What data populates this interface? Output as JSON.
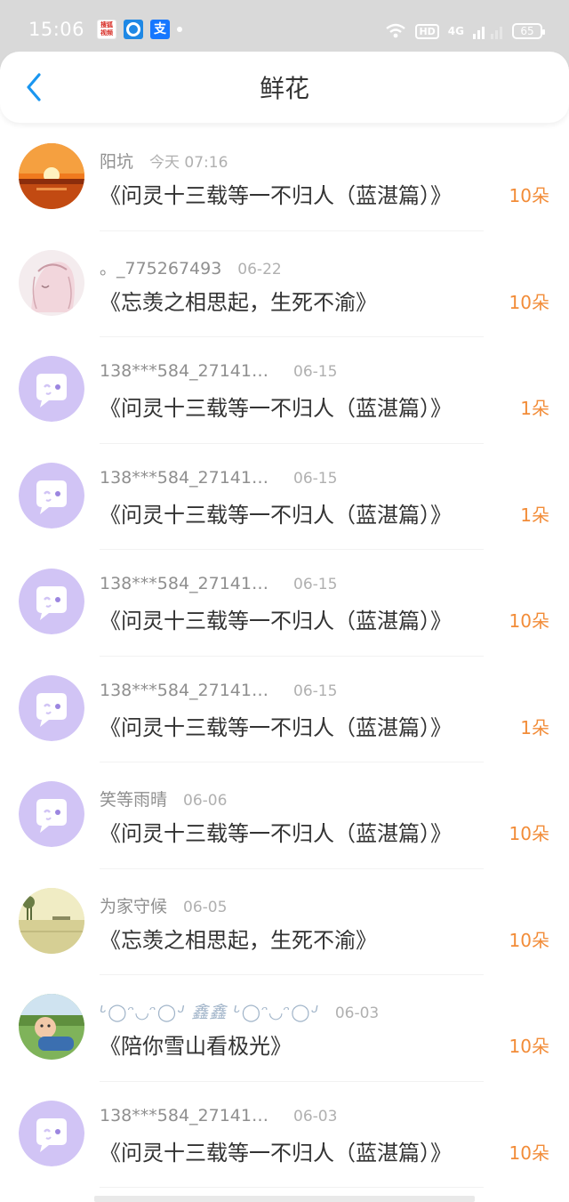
{
  "status_bar": {
    "time": "15:06",
    "apps": [
      "搜狐视频",
      "",
      "支"
    ],
    "network": "4G",
    "hd_label": "HD",
    "battery": "65"
  },
  "header": {
    "title": "鲜花"
  },
  "colors": {
    "accent": "#1a96f0",
    "count": "#f28c38",
    "avatar_bg": "#d1c4f5"
  },
  "rows": [
    {
      "user": "阳坑",
      "date": "今天 07:16",
      "work": "《问灵十三载等一不归人（蓝湛篇）》",
      "count": "10朵",
      "avatar": "sunset"
    },
    {
      "user": "。_775267493",
      "date": "06-22",
      "work": "《忘羡之相思起，生死不渝》",
      "count": "10朵",
      "avatar": "anime"
    },
    {
      "user": "138***584_27141…",
      "date": "06-15",
      "work": "《问灵十三载等一不归人（蓝湛篇）》",
      "count": "1朵",
      "avatar": "default"
    },
    {
      "user": "138***584_27141…",
      "date": "06-15",
      "work": "《问灵十三载等一不归人（蓝湛篇）》",
      "count": "1朵",
      "avatar": "default"
    },
    {
      "user": "138***584_27141…",
      "date": "06-15",
      "work": "《问灵十三载等一不归人（蓝湛篇）》",
      "count": "10朵",
      "avatar": "default"
    },
    {
      "user": "138***584_27141…",
      "date": "06-15",
      "work": "《问灵十三载等一不归人（蓝湛篇）》",
      "count": "1朵",
      "avatar": "default"
    },
    {
      "user": "笑等雨晴",
      "date": "06-06",
      "work": "《问灵十三载等一不归人（蓝湛篇）》",
      "count": "10朵",
      "avatar": "default"
    },
    {
      "user": "为家守候",
      "date": "06-05",
      "work": "《忘羡之相思起，生死不渝》",
      "count": "10朵",
      "avatar": "landscape"
    },
    {
      "user": "ᒡ◯ᵔ◡ᵔ◯ᒢ 鑫鑫 ᒡ◯ᵔ◡ᵔ◯ᒢ",
      "date": "06-03",
      "work": "《陪你雪山看极光》",
      "count": "10朵",
      "avatar": "child"
    },
    {
      "user": "138***584_27141…",
      "date": "06-03",
      "work": "《问灵十三载等一不归人（蓝湛篇）》",
      "count": "10朵",
      "avatar": "default"
    }
  ]
}
